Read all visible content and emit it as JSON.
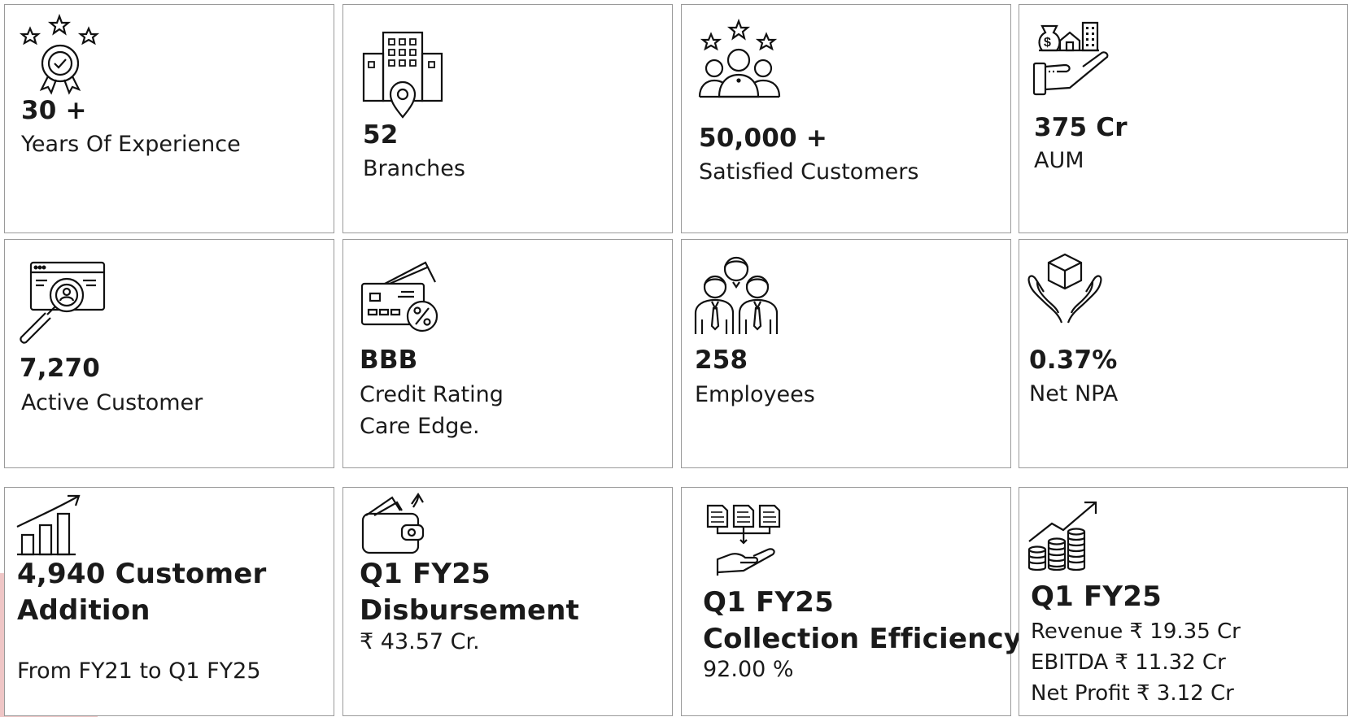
{
  "stats": {
    "experience": {
      "value": "30 +",
      "label": "Years Of Experience"
    },
    "branches": {
      "value": "52",
      "label": "Branches"
    },
    "customers": {
      "value": "50,000 +",
      "label": "Satisfied Customers"
    },
    "aum": {
      "value": "375 Cr",
      "label": "AUM"
    },
    "active_customer": {
      "value": "7,270",
      "label": "Active Customer"
    },
    "credit_rating": {
      "value": "BBB",
      "label_line1": "Credit Rating",
      "label_line2": "Care Edge."
    },
    "employees": {
      "value": "258",
      "label": "Employees"
    },
    "net_npa": {
      "value": "0.37%",
      "label": "Net NPA"
    },
    "customer_addition": {
      "value_line1": "4,940 Customer",
      "value_line2": "Addition",
      "label": "From FY21 to Q1 FY25"
    },
    "disbursement": {
      "value_line1": "Q1 FY25",
      "value_line2": "Disbursement",
      "label": "₹ 43.57 Cr."
    },
    "collection": {
      "value_line1": "Q1 FY25",
      "value_line2": "Collection Efficiency",
      "label": "92.00 %"
    },
    "financials": {
      "value": "Q1 FY25",
      "line1": "Revenue ₹ 19.35 Cr",
      "line2": "EBITDA ₹ 11.32 Cr",
      "line3": "Net Profit ₹ 3.12 Cr"
    }
  },
  "icons": {
    "experience": "award-stars-icon",
    "branches": "building-location-icon",
    "customers": "customers-stars-icon",
    "aum": "money-hand-icon",
    "active_customer": "user-search-icon",
    "credit_rating": "credit-card-percent-icon",
    "employees": "employees-group-icon",
    "net_npa": "hands-box-icon",
    "customer_addition": "growth-chart-icon",
    "disbursement": "wallet-icon",
    "collection": "documents-hand-icon",
    "financials": "coins-growth-icon"
  },
  "colors": {
    "border": "#9a9a9a",
    "text": "#1a1a1a",
    "accent_decoration": "#efc6c6"
  }
}
